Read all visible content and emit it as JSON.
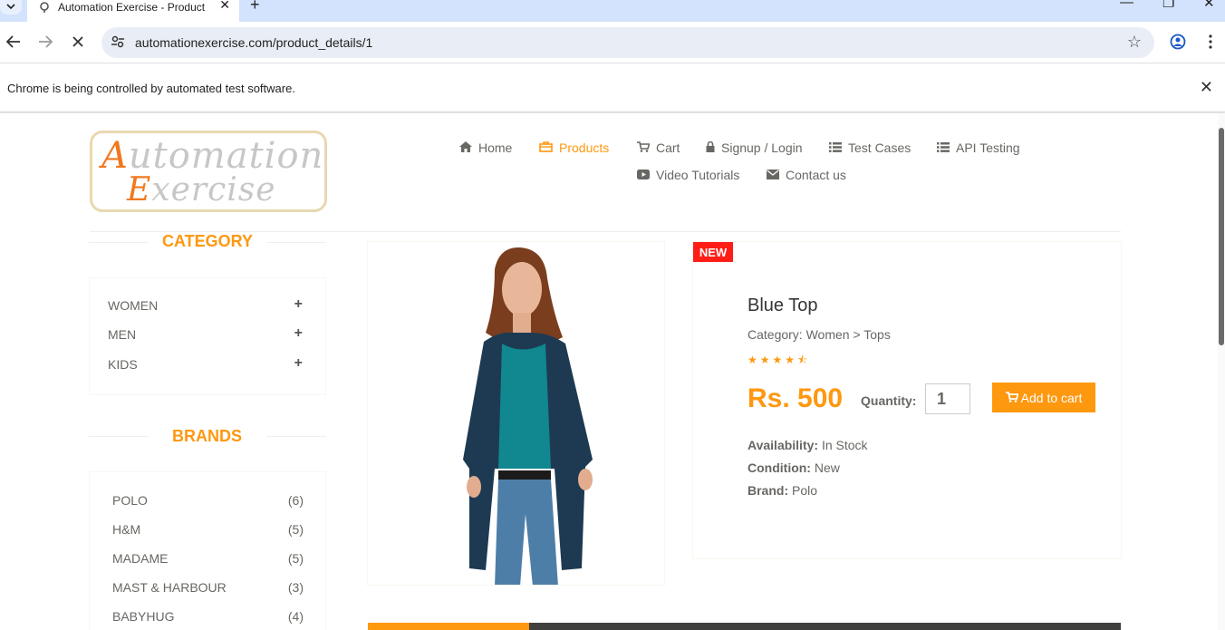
{
  "browser": {
    "tab_title": "Automation Exercise - Product D",
    "url": "automationexercise.com/product_details/1",
    "infobar_message": "Chrome is being controlled by automated test software."
  },
  "site": {
    "logo_line1": "Automation",
    "logo_line2": "Exercise",
    "nav": {
      "home": "Home",
      "products": "Products",
      "cart": "Cart",
      "signup": "Signup / Login",
      "test_cases": "Test Cases",
      "api_testing": "API Testing",
      "video_tutorials": "Video Tutorials",
      "contact": "Contact us"
    }
  },
  "sidebar": {
    "category_title": "CATEGORY",
    "categories": [
      "WOMEN",
      "MEN",
      "KIDS"
    ],
    "brands_title": "BRANDS",
    "brands": [
      {
        "name": "POLO",
        "count": "(6)"
      },
      {
        "name": "H&M",
        "count": "(5)"
      },
      {
        "name": "MADAME",
        "count": "(5)"
      },
      {
        "name": "MAST & HARBOUR",
        "count": "(3)"
      },
      {
        "name": "BABYHUG",
        "count": "(4)"
      }
    ]
  },
  "product": {
    "badge": "NEW",
    "name": "Blue Top",
    "category": "Category: Women > Tops",
    "rating": 4.5,
    "price": "Rs. 500",
    "quantity_label": "Quantity:",
    "quantity": "1",
    "add_to_cart": "Add to cart",
    "availability_label": "Availability:",
    "availability": "In Stock",
    "condition_label": "Condition:",
    "condition": "New",
    "brand_label": "Brand:",
    "brand": "Polo"
  },
  "colors": {
    "accent": "#fe980f",
    "badge": "#fe1e16",
    "text": "#696763"
  }
}
